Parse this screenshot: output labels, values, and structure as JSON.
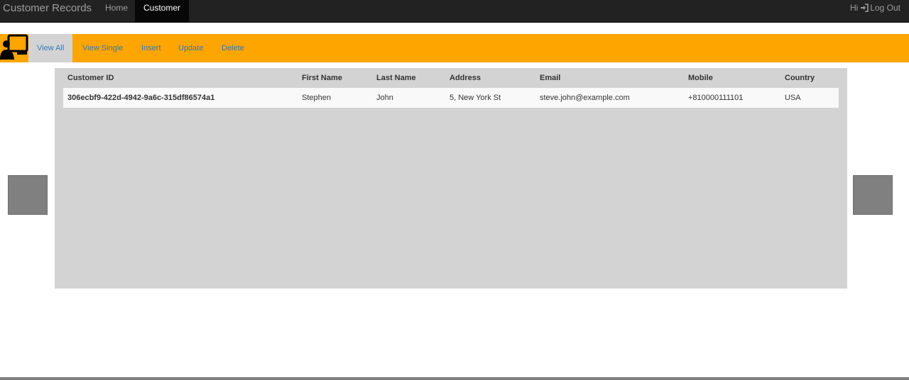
{
  "navbar": {
    "brand": "Customer Records",
    "items": [
      {
        "label": "Home",
        "active": false
      },
      {
        "label": "Customer",
        "active": true
      }
    ],
    "greeting": "Hi",
    "logout_label": "Log Out",
    "logout_icon": "sign-in-icon"
  },
  "subnav": {
    "logo_icon": "monitor-user-icon",
    "items": [
      {
        "label": "View All",
        "active": true
      },
      {
        "label": "View Single",
        "active": false
      },
      {
        "label": "Insert",
        "active": false
      },
      {
        "label": "Update",
        "active": false
      },
      {
        "label": "Delete",
        "active": false
      }
    ],
    "bg_color": "#ffa500",
    "link_color": "#337ab7"
  },
  "table": {
    "headers": [
      "Customer ID",
      "First Name",
      "Last Name",
      "Address",
      "Email",
      "Mobile",
      "Country"
    ],
    "rows": [
      {
        "id": "306ecbf9-422d-4942-9a6c-315df86574a1",
        "first_name": "Stephen",
        "last_name": "John",
        "address": "5, New York St",
        "email": "steve.john@example.com",
        "mobile": "+810000111101",
        "country": "USA"
      }
    ]
  },
  "carousel": {
    "prev_icon": "previous-arrow-icon",
    "next_icon": "next-arrow-icon"
  }
}
